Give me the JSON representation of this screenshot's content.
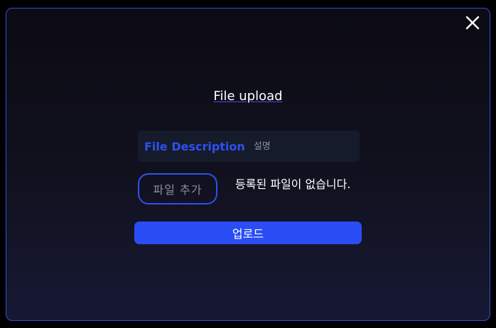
{
  "modal": {
    "title": "File upload",
    "close_icon": "close-icon",
    "description": {
      "label": "File Description",
      "value": "",
      "placeholder": "설명"
    },
    "add_file_label": "파일 추가",
    "no_file_message": "등록된 파일이 없습니다.",
    "upload_label": "업로드"
  },
  "colors": {
    "accent": "#2b4df5",
    "border": "#2f4fd6",
    "background": "#0c0b14",
    "input_background": "#151b2b"
  }
}
